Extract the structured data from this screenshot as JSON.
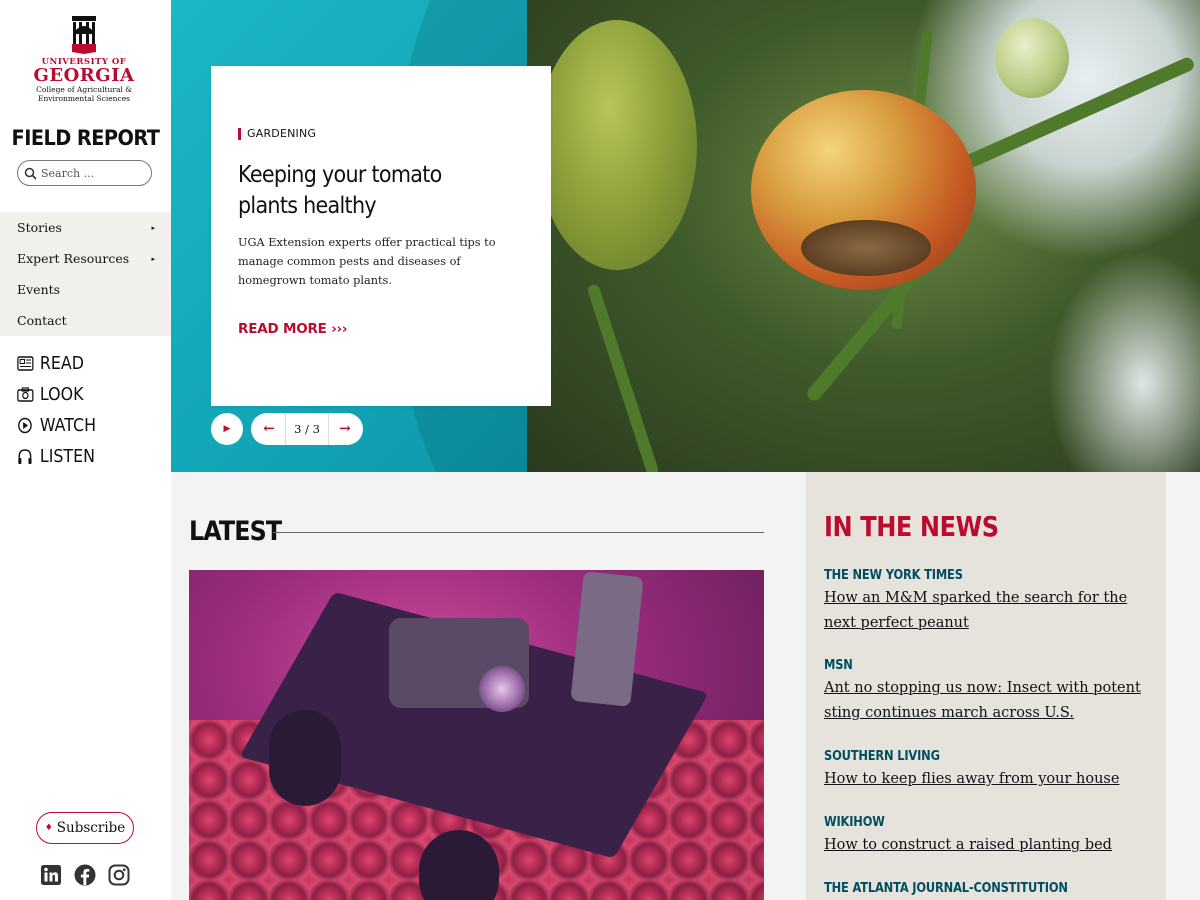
{
  "sidebar": {
    "logo": {
      "university": "UNIVERSITY OF",
      "georgia": "GEORGIA",
      "college_line1": "College of Agricultural &",
      "college_line2": "Environmental Sciences"
    },
    "site_title": "FIELD REPORT",
    "search": {
      "placeholder": "Search ..."
    },
    "nav": [
      {
        "label": "Stories",
        "has_submenu": true,
        "arrow": "▸"
      },
      {
        "label": "Expert Resources",
        "has_submenu": true,
        "arrow": "▸"
      },
      {
        "label": "Events",
        "has_submenu": false
      },
      {
        "label": "Contact",
        "has_submenu": false
      }
    ],
    "media": [
      {
        "label": "READ",
        "icon": "newspaper-icon"
      },
      {
        "label": "LOOK",
        "icon": "camera-icon"
      },
      {
        "label": "WATCH",
        "icon": "play-circle-icon"
      },
      {
        "label": "LISTEN",
        "icon": "headphones-icon"
      }
    ],
    "subscribe_label": "Subscribe",
    "social": [
      "linkedin-icon",
      "facebook-icon",
      "instagram-icon"
    ]
  },
  "hero": {
    "category": "GARDENING",
    "title": "Keeping your tomato plants healthy",
    "summary": "UGA Extension experts offer practical tips to manage common pests and diseases of homegrown tomato plants.",
    "read_more": "READ MORE ›››",
    "slide_counter": "3 / 3"
  },
  "latest": {
    "heading": "LATEST"
  },
  "in_the_news": {
    "heading": "IN THE NEWS",
    "items": [
      {
        "source": "THE NEW YORK TIMES",
        "headline": "How an M&M sparked the search for the next perfect peanut"
      },
      {
        "source": "MSN",
        "headline": "Ant no stopping us now: Insect with potent sting continues march across U.S."
      },
      {
        "source": "SOUTHERN LIVING",
        "headline": "How to keep flies away from your house"
      },
      {
        "source": "WIKIHOW",
        "headline": "How to construct a raised planting bed"
      },
      {
        "source": "THE ATLANTA JOURNAL-CONSTITUTION",
        "headline": ""
      }
    ]
  },
  "colors": {
    "brand_red": "#ba0c2f",
    "news_teal": "#004e60",
    "hero_teal": "#12a6b7",
    "news_bg": "#e6e3dc"
  }
}
